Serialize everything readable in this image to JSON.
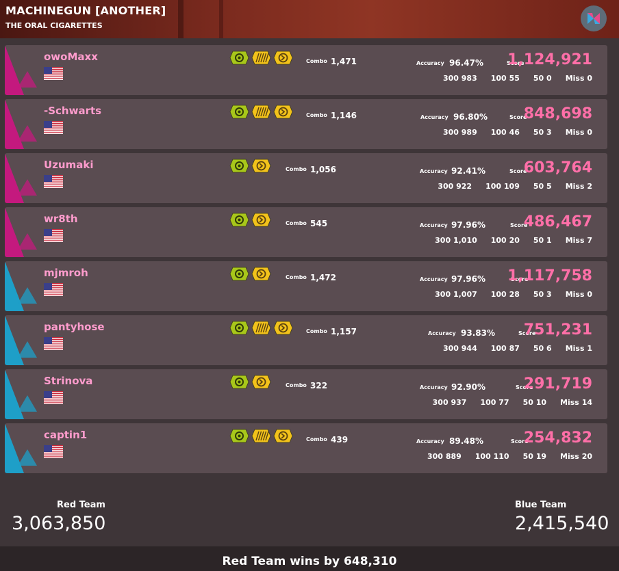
{
  "header": {
    "title": "MACHINEGUN [ANOTHER]",
    "artist": "THE ORAL CIGARETTES",
    "logo_icon": "app-logo-bowtie-icon"
  },
  "colors": {
    "red_team": "#c4197e",
    "blue_team": "#1e9fc8",
    "name": "#ff9ccd",
    "score": "#ff6fa8"
  },
  "labels": {
    "combo": "Combo",
    "accuracy": "Accuracy",
    "score": "Score",
    "h300": "300",
    "h100": "100",
    "h50": "50",
    "miss": "Miss"
  },
  "players": [
    {
      "name": "owoMaxx",
      "team": "red",
      "mods": [
        "HD",
        "DT",
        "NC"
      ],
      "combo": "1,471",
      "accuracy": "96.47%",
      "score": "1,124,921",
      "h300": "983",
      "h100": "55",
      "h50": "0",
      "miss": "0"
    },
    {
      "name": "-Schwarts",
      "team": "red",
      "mods": [
        "HD",
        "DT",
        "NC"
      ],
      "combo": "1,146",
      "accuracy": "96.80%",
      "score": "848,698",
      "h300": "989",
      "h100": "46",
      "h50": "3",
      "miss": "0"
    },
    {
      "name": "Uzumaki",
      "team": "red",
      "mods": [
        "HD",
        "NC"
      ],
      "combo": "1,056",
      "accuracy": "92.41%",
      "score": "603,764",
      "h300": "922",
      "h100": "109",
      "h50": "5",
      "miss": "2"
    },
    {
      "name": "wr8th",
      "team": "red",
      "mods": [
        "HD",
        "NC"
      ],
      "combo": "545",
      "accuracy": "97.96%",
      "score": "486,467",
      "h300": "1,010",
      "h100": "20",
      "h50": "1",
      "miss": "7"
    },
    {
      "name": "mjmroh",
      "team": "blue",
      "mods": [
        "HD",
        "NC"
      ],
      "combo": "1,472",
      "accuracy": "97.96%",
      "score": "1,117,758",
      "h300": "1,007",
      "h100": "28",
      "h50": "3",
      "miss": "0"
    },
    {
      "name": "pantyhose",
      "team": "blue",
      "mods": [
        "HD",
        "DT",
        "NC"
      ],
      "combo": "1,157",
      "accuracy": "93.83%",
      "score": "751,231",
      "h300": "944",
      "h100": "87",
      "h50": "6",
      "miss": "1"
    },
    {
      "name": "Strinova",
      "team": "blue",
      "mods": [
        "HD",
        "NC"
      ],
      "combo": "322",
      "accuracy": "92.90%",
      "score": "291,719",
      "h300": "937",
      "h100": "77",
      "h50": "10",
      "miss": "14"
    },
    {
      "name": "captin1",
      "team": "blue",
      "mods": [
        "HD",
        "DT",
        "NC"
      ],
      "combo": "439",
      "accuracy": "89.48%",
      "score": "254,832",
      "h300": "889",
      "h100": "110",
      "h50": "19",
      "miss": "20"
    }
  ],
  "footer": {
    "red_label": "Red Team",
    "red_score": "3,063,850",
    "blue_label": "Blue Team",
    "blue_score": "2,415,540",
    "result": "Red Team wins by 648,310"
  }
}
